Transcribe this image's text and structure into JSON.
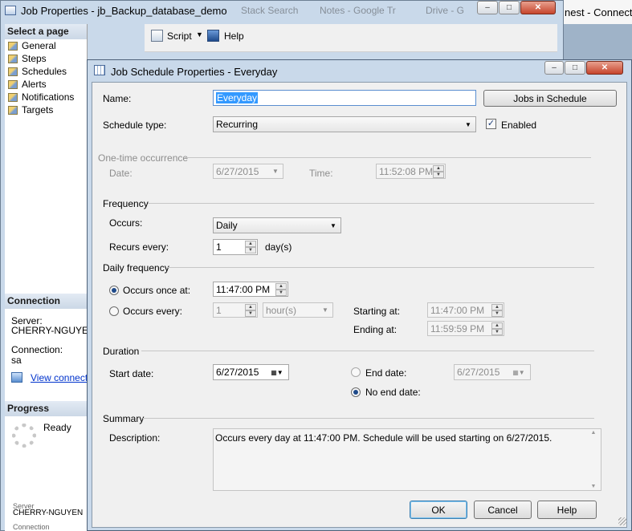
{
  "taskbar": {
    "right_text": "nest - Connecting",
    "faded_items": [
      "Stack Search",
      "Notes - Google Tr",
      "Drive - G"
    ]
  },
  "outer_window": {
    "title": "Job Properties - jb_Backup_database_demo",
    "select_page_header": "Select a page",
    "pages": [
      "General",
      "Steps",
      "Schedules",
      "Alerts",
      "Notifications",
      "Targets"
    ],
    "toolbar": {
      "script_label": "Script",
      "help_label": "Help"
    },
    "connection": {
      "header": "Connection",
      "server_label": "Server:",
      "server_value": "CHERRY-NGUYEN",
      "connection_label": "Connection:",
      "connection_value": "sa",
      "view_link": "View connection"
    },
    "progress": {
      "header": "Progress",
      "status": "Ready"
    },
    "bottom": {
      "server_label": "Server",
      "server_value": "CHERRY-NGUYEN",
      "connection_label": "Connection"
    }
  },
  "dialog": {
    "title": "Job Schedule Properties - Everyday",
    "name_label": "Name:",
    "name_value": "Everyday",
    "jobs_button": "Jobs in Schedule",
    "schedule_type_label": "Schedule type:",
    "schedule_type_value": "Recurring",
    "enabled_label": "Enabled",
    "enabled_checked": true,
    "one_time": {
      "header": "One-time occurrence",
      "date_label": "Date:",
      "date_value": "6/27/2015",
      "time_label": "Time:",
      "time_value": "11:52:08 PM"
    },
    "frequency": {
      "header": "Frequency",
      "occurs_label": "Occurs:",
      "occurs_value": "Daily",
      "recurs_label": "Recurs every:",
      "recurs_value": "1",
      "recurs_unit": "day(s)"
    },
    "daily_frequency": {
      "header": "Daily frequency",
      "once_label": "Occurs once at:",
      "once_value": "11:47:00 PM",
      "every_label": "Occurs every:",
      "every_value": "1",
      "every_unit": "hour(s)",
      "starting_label": "Starting at:",
      "starting_value": "11:47:00 PM",
      "ending_label": "Ending at:",
      "ending_value": "11:59:59 PM"
    },
    "duration": {
      "header": "Duration",
      "start_label": "Start date:",
      "start_value": "6/27/2015",
      "end_label": "End date:",
      "end_value": "6/27/2015",
      "no_end_label": "No end date:"
    },
    "summary": {
      "header": "Summary",
      "description_label": "Description:",
      "description_value": "Occurs every day at 11:47:00 PM. Schedule will be used starting on 6/27/2015."
    },
    "buttons": {
      "ok": "OK",
      "cancel": "Cancel",
      "help": "Help"
    }
  }
}
